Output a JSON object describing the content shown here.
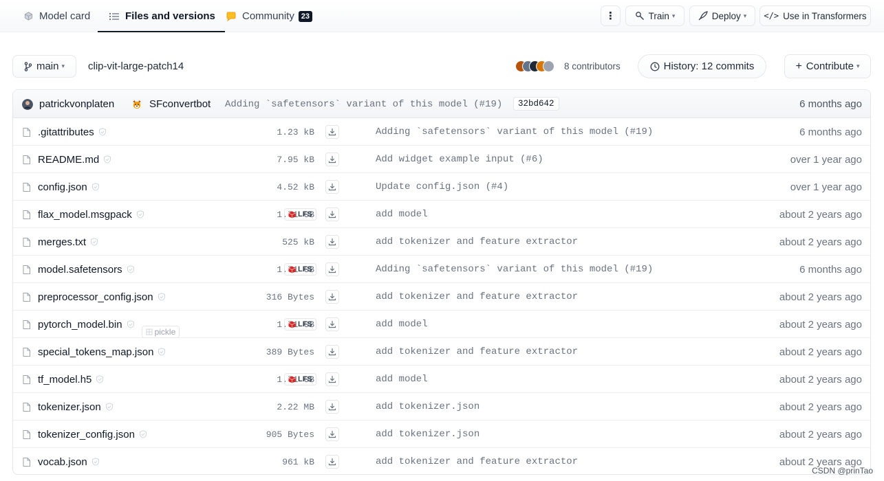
{
  "tabs": [
    {
      "label": "Model card",
      "icon": "cube-icon"
    },
    {
      "label": "Files and versions",
      "icon": "files-icon"
    },
    {
      "label": "Community",
      "icon": "chat-icon",
      "count": "23"
    }
  ],
  "toolbar": {
    "more_label": "⋮",
    "train_label": "Train",
    "deploy_label": "Deploy",
    "transformers_label": "Use in Transformers"
  },
  "repo": {
    "branch": "main",
    "name": "clip-vit-large-patch14",
    "contributors": "8 contributors",
    "history": "History: 12 commits",
    "contribute": "Contribute"
  },
  "avatar_colors": [
    "#b45309",
    "#64748b",
    "#1f2937",
    "#d97706",
    "#9ca3af"
  ],
  "last_commit": {
    "author": "patrickvonplaten",
    "coauthor": "SFconvertbot",
    "message": "Adding `safetensors` variant of this model (#19)",
    "hash": "32bd642",
    "time": "6 months ago"
  },
  "files": [
    {
      "name": ".gitattributes",
      "size": "1.23 kB",
      "lfs": false,
      "pickle": false,
      "message": "Adding `safetensors` variant of this model (#19)",
      "time": "6 months ago"
    },
    {
      "name": "README.md",
      "size": "7.95 kB",
      "lfs": false,
      "pickle": false,
      "message": "Add widget example input (#6)",
      "time": "over 1 year ago"
    },
    {
      "name": "config.json",
      "size": "4.52 kB",
      "lfs": false,
      "pickle": false,
      "message": "Update config.json (#4)",
      "time": "over 1 year ago"
    },
    {
      "name": "flax_model.msgpack",
      "size": "1.71 GB",
      "lfs": true,
      "pickle": false,
      "message": "add model",
      "time": "about 2 years ago"
    },
    {
      "name": "merges.txt",
      "size": "525 kB",
      "lfs": false,
      "pickle": false,
      "message": "add tokenizer and feature extractor",
      "time": "about 2 years ago"
    },
    {
      "name": "model.safetensors",
      "size": "1.71 GB",
      "lfs": true,
      "pickle": false,
      "message": "Adding `safetensors` variant of this model (#19)",
      "time": "6 months ago"
    },
    {
      "name": "preprocessor_config.json",
      "size": "316 Bytes",
      "lfs": false,
      "pickle": false,
      "message": "add tokenizer and feature extractor",
      "time": "about 2 years ago"
    },
    {
      "name": "pytorch_model.bin",
      "size": "1.71 GB",
      "lfs": true,
      "pickle": true,
      "message": "add model",
      "time": "about 2 years ago"
    },
    {
      "name": "special_tokens_map.json",
      "size": "389 Bytes",
      "lfs": false,
      "pickle": false,
      "message": "add tokenizer and feature extractor",
      "time": "about 2 years ago"
    },
    {
      "name": "tf_model.h5",
      "size": "1.71 GB",
      "lfs": true,
      "pickle": false,
      "message": "add model",
      "time": "about 2 years ago"
    },
    {
      "name": "tokenizer.json",
      "size": "2.22 MB",
      "lfs": false,
      "pickle": false,
      "message": "add tokenizer.json",
      "time": "about 2 years ago"
    },
    {
      "name": "tokenizer_config.json",
      "size": "905 Bytes",
      "lfs": false,
      "pickle": false,
      "message": "add tokenizer.json",
      "time": "about 2 years ago"
    },
    {
      "name": "vocab.json",
      "size": "961 kB",
      "lfs": false,
      "pickle": false,
      "message": "add tokenizer and feature extractor",
      "time": "about 2 years ago"
    }
  ],
  "labels": {
    "lfs": "LFS",
    "pickle": "pickle"
  },
  "watermark": "CSDN @prinTao"
}
